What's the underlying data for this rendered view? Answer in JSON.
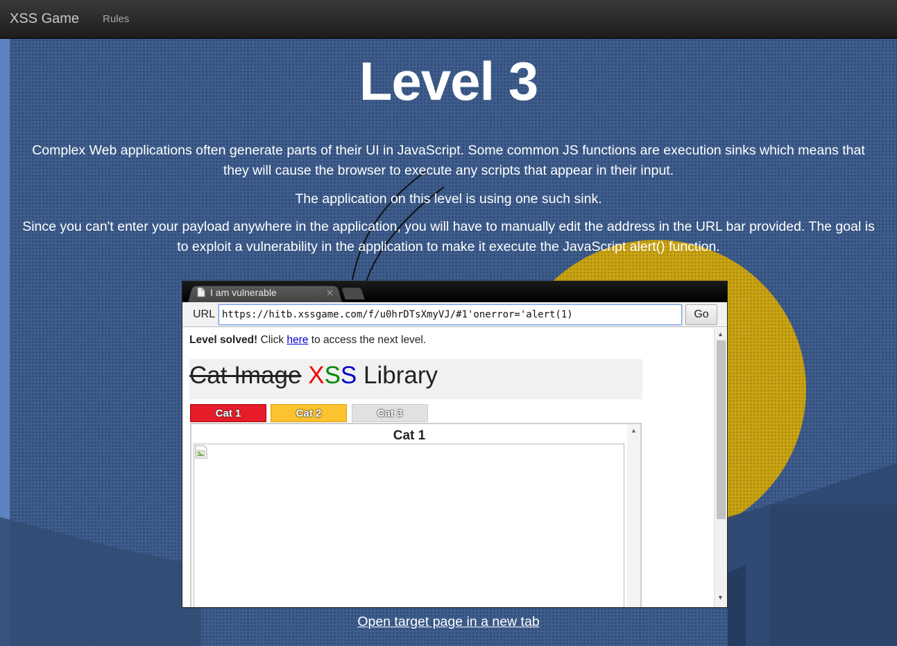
{
  "navbar": {
    "brand": "XSS Game",
    "rules_label": "Rules"
  },
  "main": {
    "title": "Level 3",
    "paragraphs": [
      "Complex Web applications often generate parts of their UI in JavaScript. Some common JS functions are execution sinks which means that they will cause the browser to execute any scripts that appear in their input.",
      "The application on this level is using one such sink.",
      "Since you can't enter your payload anywhere in the application, you will have to manually edit the address in the URL bar provided. The goal is to exploit a vulnerability in the application to make it execute the JavaScript alert() function."
    ],
    "open_link": "Open target page in a new tab"
  },
  "browser": {
    "tab_title": "I am vulnerable",
    "tab_close_glyph": "✕",
    "url_label": "URL",
    "url_value": "https://hitb.xssgame.com/f/u0hrDTsXmyVJ/#1'onerror='alert(1)",
    "go_label": "Go"
  },
  "target": {
    "solved_bold": "Level solved!",
    "solved_pre": " Click ",
    "solved_link": "here",
    "solved_post": " to access the next level.",
    "title_struck": "Cat Image",
    "title_x": "X",
    "title_s1": "S",
    "title_s2": "S",
    "title_rest": " Library",
    "tabs": [
      "Cat 1",
      "Cat 2",
      "Cat 3"
    ],
    "frame_title": "Cat 1"
  },
  "colors": {
    "background": "#3e5d8c",
    "sun": "#c9a313",
    "cat1": "#e61c2b",
    "cat2": "#fcc22f",
    "cat3": "#e1e1e1"
  }
}
